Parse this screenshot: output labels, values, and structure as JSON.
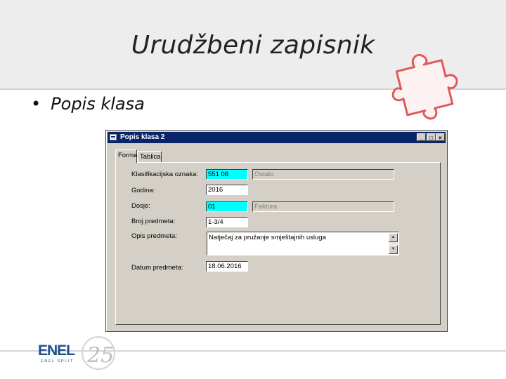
{
  "slide": {
    "title": "Urudžbeni zapisnik",
    "bullet": "Popis klasa"
  },
  "window": {
    "title": "Popis klasa   2",
    "minimize": "_",
    "maximize": "□",
    "close": "×"
  },
  "tabs": [
    {
      "label": "Forma"
    },
    {
      "label": "Tablica"
    }
  ],
  "form": {
    "klasifikacija_label": "Klasifikacijska oznaka:",
    "klasifikacija_value": "551 08",
    "klasifikacija_desc": "Ostalo",
    "godina_label": "Godina:",
    "godina_value": "2016",
    "dosje_label": "Dosje:",
    "dosje_value": "01",
    "dosje_desc": "Faktura",
    "broj_label": "Broj predmeta:",
    "broj_value": "1-3/4",
    "opis_label": "Opis predmeta:",
    "opis_value": "Natječaj za pružanje smještajnih usluga",
    "datum_label": "Datum predmeta:",
    "datum_value": "18.06.2016"
  },
  "logo": {
    "brand": "ENEL",
    "subtitle": "ENEL SPLIT",
    "anniversary": "25"
  },
  "colors": {
    "titlebar": "#0a246a",
    "highlight_field": "#00ffff",
    "dialog_face": "#d4d0c8",
    "puzzle": "#e05a5a",
    "logo_blue": "#1d4f8a"
  }
}
